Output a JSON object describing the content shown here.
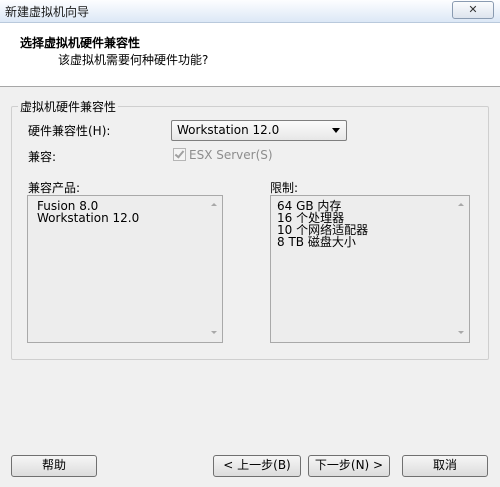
{
  "window": {
    "title": "新建虚拟机向导",
    "close_label": "✕"
  },
  "header": {
    "title": "选择虚拟机硬件兼容性",
    "subtitle": "该虚拟机需要何种硬件功能?"
  },
  "group": {
    "legend": "虚拟机硬件兼容性",
    "compat_label": "硬件兼容性(H):",
    "compat_value": "Workstation 12.0",
    "compatible_label": "兼容:",
    "esx_label": "ESX Server(S)",
    "esx_checked": true,
    "products_label": "兼容产品:",
    "products": [
      "Fusion 8.0",
      "Workstation 12.0"
    ],
    "limits_label": "限制:",
    "limits": [
      "64 GB 内存",
      "16 个处理器",
      "10 个网络适配器",
      "8 TB 磁盘大小"
    ]
  },
  "buttons": {
    "help": "帮助",
    "back": "< 上一步(B)",
    "next": "下一步(N) >",
    "cancel": "取消"
  }
}
